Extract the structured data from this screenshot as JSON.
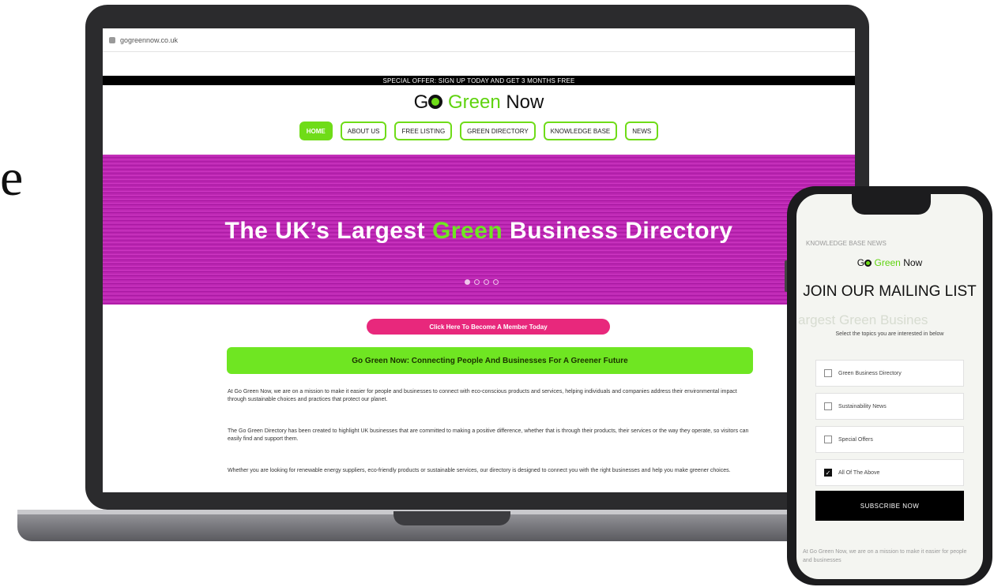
{
  "edge_text": "e",
  "browser": {
    "url": "gogreennow.co.uk"
  },
  "site": {
    "announcement": "SPECIAL OFFER: SIGN UP TODAY AND GET 3 MONTHS FREE",
    "brand": {
      "prefix": "G",
      "green": "Green",
      "suffix": "Now"
    },
    "nav": [
      "HOME",
      "ABOUT US",
      "FREE LISTING",
      "GREEN DIRECTORY",
      "KNOWLEDGE BASE",
      "NEWS"
    ],
    "hero": {
      "title_before": "The UK’s Largest ",
      "title_green": "Green",
      "title_after": " Business Directory"
    },
    "cta_pink": "Click Here To Become A Member Today",
    "cta_green": "Go Green Now: Connecting People And Businesses For A Greener Future",
    "paragraphs": [
      "At Go Green Now, we are on a mission to make it easier for people and businesses to connect with eco-conscious products and services, helping individuals and companies address their environmental impact through sustainable choices and practices that protect our planet.",
      "The Go Green Directory has been created to highlight UK businesses that are committed to making a positive difference, whether that is through their products, their services or the way they operate, so visitors can easily find and support them.",
      "Whether you are looking for renewable energy suppliers, eco-friendly products or sustainable services, our directory is designed to connect you with the right businesses and help you make greener choices."
    ]
  },
  "phone": {
    "top_text": "KNOWLEDGE BASE   NEWS",
    "brand": {
      "prefix": "G",
      "green": "Green",
      "suffix": "Now"
    },
    "title": "JOIN OUR MAILING LIST",
    "ghost_text": "argest Green Busines",
    "subtitle": "Select the topics you are interested in below",
    "options": [
      {
        "label": "Green Business Directory",
        "checked": false
      },
      {
        "label": "Sustainability News",
        "checked": false
      },
      {
        "label": "Special Offers",
        "checked": false
      },
      {
        "label": "All Of The Above",
        "checked": true
      }
    ],
    "submit": "SUBSCRIBE NOW",
    "footer": "At Go Green Now, we are on a mission to make it easier for people and businesses"
  }
}
